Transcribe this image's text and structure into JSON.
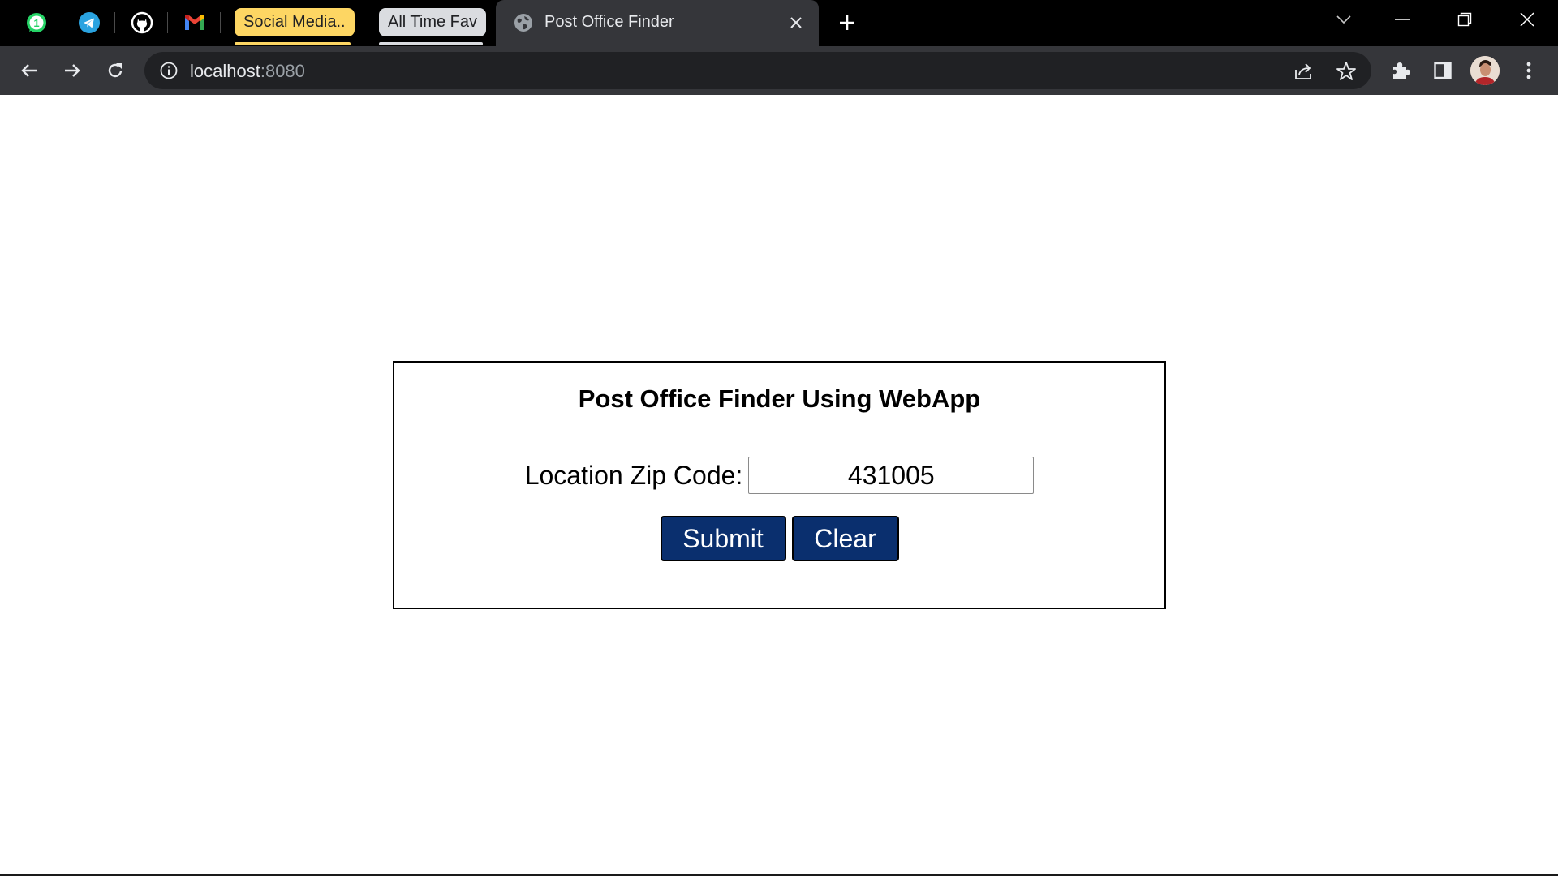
{
  "browser": {
    "pinned_tabs": [
      {
        "name": "whatsapp",
        "badge": "1"
      },
      {
        "name": "telegram"
      },
      {
        "name": "github"
      },
      {
        "name": "gmail"
      }
    ],
    "tab_groups": [
      {
        "label": "Social Media..",
        "color": "#fdd663"
      },
      {
        "label": "All Time Fav",
        "color": "#dadce0"
      }
    ],
    "active_tab": {
      "title": "Post Office Finder"
    },
    "address": {
      "host": "localhost",
      "port": ":8080"
    }
  },
  "page": {
    "title": "Post Office Finder Using WebApp",
    "zip_label": "Location Zip Code:",
    "zip_value": "431005",
    "submit_label": "Submit",
    "clear_label": "Clear"
  },
  "colors": {
    "button_bg": "#0a2f6e",
    "tab_strip_bg": "#000000",
    "toolbar_bg": "#35363a"
  }
}
